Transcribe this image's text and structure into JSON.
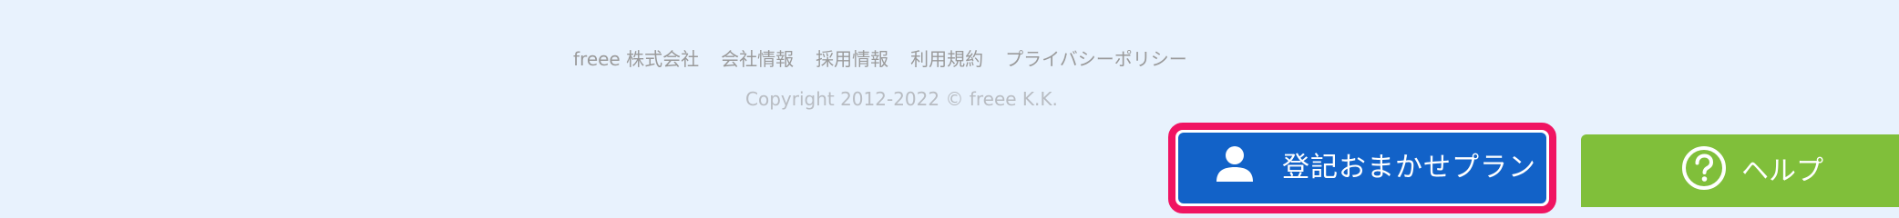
{
  "footer": {
    "links": [
      "freee 株式会社",
      "会社情報",
      "採用情報",
      "利用規約",
      "プライバシーポリシー"
    ],
    "copyright": "Copyright 2012-2022 © freee K.K."
  },
  "plan_button": {
    "label": "登記おまかせプラン",
    "icon": "person-icon",
    "highlight_color": "#f01462",
    "background_color": "#1262c8"
  },
  "help_button": {
    "label": "ヘルプ",
    "icon": "question-circle-icon",
    "background_color": "#80bf3a"
  }
}
